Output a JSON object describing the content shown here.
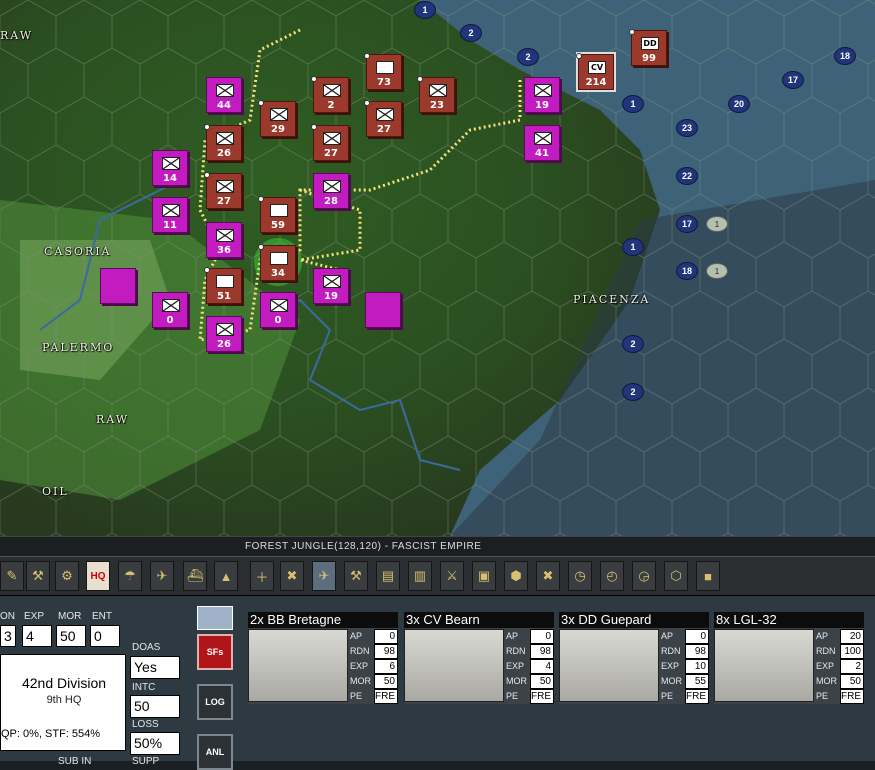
{
  "map": {
    "cities": [
      "CASORIA",
      "PALERMO",
      "RAW",
      "OIL",
      "PIACENZA"
    ],
    "top_left_label": "RAW",
    "player_units": [
      {
        "strength": "44"
      },
      {
        "strength": "14"
      },
      {
        "strength": "26"
      },
      {
        "strength": "27"
      },
      {
        "strength": "11"
      },
      {
        "strength": "36"
      },
      {
        "strength": "28"
      },
      {
        "strength": "19"
      },
      {
        "strength": "41"
      },
      {
        "strength": "0"
      },
      {
        "strength": "0"
      },
      {
        "strength": "26"
      },
      {
        "strength": "19"
      }
    ],
    "enemy_units": [
      {
        "strength": "73"
      },
      {
        "strength": "2"
      },
      {
        "strength": "29"
      },
      {
        "strength": "27"
      },
      {
        "strength": "27"
      },
      {
        "strength": "23"
      },
      {
        "strength": "59"
      },
      {
        "strength": "34"
      },
      {
        "strength": "51"
      },
      {
        "strength": "99",
        "symbol": "DD"
      },
      {
        "strength": "214",
        "symbol": "CV"
      }
    ],
    "naval_markers": [
      "1",
      "2",
      "2",
      "1",
      "23",
      "22",
      "17",
      "1",
      "18",
      "2",
      "2",
      "17",
      "20",
      "18"
    ],
    "sub_markers": [
      "1",
      "1"
    ]
  },
  "status": {
    "hex_info": "FOREST JUNGLE(128,120) - FASCIST EMPIRE"
  },
  "toolbar": {
    "hq_label": "HQ"
  },
  "unit_panel": {
    "headers": {
      "on": "ON",
      "exp": "EXP",
      "mor": "MOR",
      "ent": "ENT"
    },
    "values": {
      "on": "3",
      "exp": "4",
      "mor": "50",
      "ent": "0"
    },
    "unit_name": "42nd Division",
    "unit_hq": "9th HQ",
    "supply_line": "QP: 0%, STF: 554%",
    "doas_label": "DOAS",
    "doas_value": "Yes",
    "intc_label": "INTC",
    "intc_value": "50",
    "loss_label": "LOSS",
    "loss_value": "50%",
    "bottom_labels": [
      "SUB IN",
      "SUPP"
    ]
  },
  "side_buttons": {
    "sfs": "SFs",
    "log": "LOG",
    "anl": "ANL"
  },
  "stack": [
    {
      "name": "2x BB Bretagne",
      "stats": [
        [
          "AP",
          "0"
        ],
        [
          "RDN",
          "98"
        ],
        [
          "EXP",
          "6"
        ],
        [
          "MOR",
          "50"
        ],
        [
          "PE",
          "FRE"
        ]
      ]
    },
    {
      "name": "3x CV Bearn",
      "stats": [
        [
          "AP",
          "0"
        ],
        [
          "RDN",
          "98"
        ],
        [
          "EXP",
          "4"
        ],
        [
          "MOR",
          "50"
        ],
        [
          "PE",
          "FRE"
        ]
      ]
    },
    {
      "name": "3x DD Guepard",
      "stats": [
        [
          "AP",
          "0"
        ],
        [
          "RDN",
          "98"
        ],
        [
          "EXP",
          "10"
        ],
        [
          "MOR",
          "55"
        ],
        [
          "PE",
          "FRE"
        ]
      ]
    },
    {
      "name": "8x LGL-32",
      "stats": [
        [
          "AP",
          "20"
        ],
        [
          "RDN",
          "100"
        ],
        [
          "EXP",
          "2"
        ],
        [
          "MOR",
          "50"
        ],
        [
          "PE",
          "FRE"
        ]
      ]
    }
  ],
  "colors": {
    "player": "#c21bc0",
    "enemy": "#9b3a2c",
    "sea": "#3e6379",
    "land": "#3c7a2c",
    "naval": "#22347a"
  }
}
